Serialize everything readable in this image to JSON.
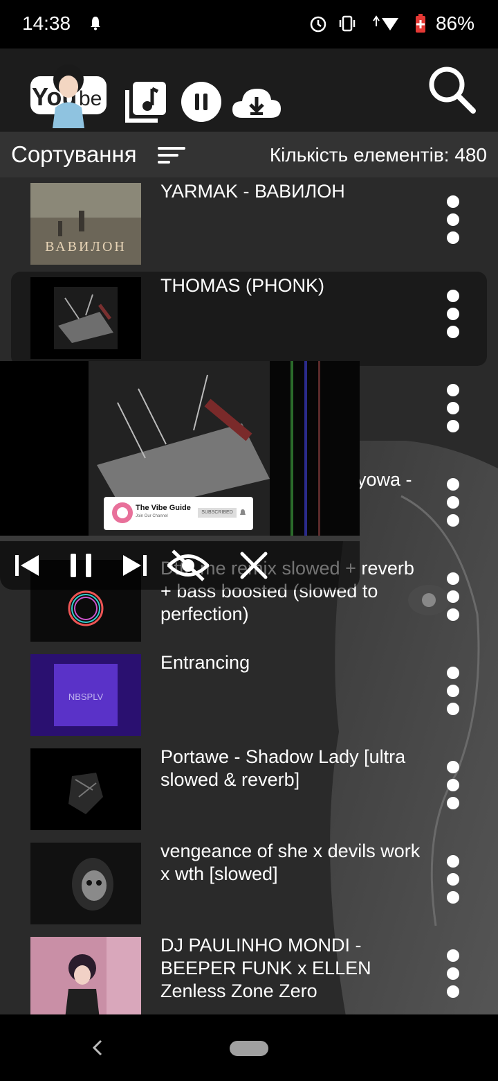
{
  "status_bar": {
    "time": "14:38",
    "battery": "86%"
  },
  "app": {
    "logo_text": "YouTube"
  },
  "sort": {
    "label": "Сортування",
    "count_label": "Кількість елементів: 480"
  },
  "items": [
    {
      "title": "YARMAK - ВАВИЛОН",
      "thumb_text": "ВАВИЛОН"
    },
    {
      "title": "THOMAS (PHONK)"
    },
    {
      "title": ""
    },
    {
      "title": "yowa -"
    },
    {
      "title": "Dtto me remix slowed + reverb + bass boosted (slowed to perfection)"
    },
    {
      "title": "Entrancing",
      "thumb_text": "NBSPLV"
    },
    {
      "title": "Portawe - Shadow Lady [ultra slowed & reverb]"
    },
    {
      "title": "vengeance of she x devils work x wth [slowed]"
    },
    {
      "title": "DJ PAULINHO MONDI - BEEPER FUNK x ELLEN Zenless Zone Zero"
    }
  ],
  "player": {
    "overlay_title": "The Vibe Guide",
    "overlay_sub": "Join Our Channel",
    "overlay_button": "SUBSCRIBED"
  },
  "icons": {
    "status": [
      "bell-icon",
      "alarm-icon",
      "vibrate-icon",
      "signal-icon",
      "battery-icon"
    ],
    "appbar": [
      "playlist-icon",
      "pause-icon",
      "download-icon",
      "search-icon"
    ],
    "player": [
      "previous-icon",
      "pause-icon",
      "next-icon",
      "hide-icon",
      "close-icon"
    ]
  }
}
